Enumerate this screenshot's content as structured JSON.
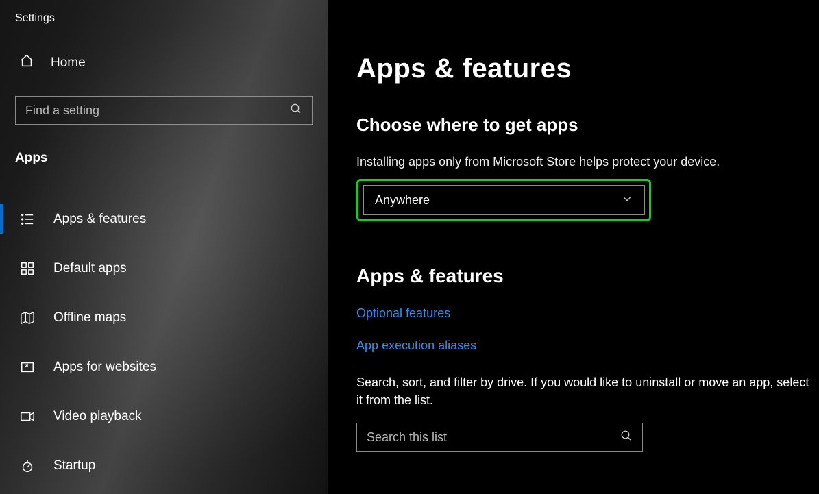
{
  "window": {
    "title": "Settings"
  },
  "sidebar": {
    "home": "Home",
    "search_placeholder": "Find a setting",
    "section": "Apps",
    "items": [
      {
        "label": "Apps & features",
        "active": true
      },
      {
        "label": "Default apps"
      },
      {
        "label": "Offline maps"
      },
      {
        "label": "Apps for websites"
      },
      {
        "label": "Video playback"
      },
      {
        "label": "Startup"
      }
    ]
  },
  "main": {
    "title": "Apps & features",
    "choose_heading": "Choose where to get apps",
    "choose_helper": "Installing apps only from Microsoft Store helps protect your device.",
    "choose_value": "Anywhere",
    "section2_heading": "Apps & features",
    "link_optional": "Optional features",
    "link_aliases": "App execution aliases",
    "list_desc": "Search, sort, and filter by drive. If you would like to uninstall or move an app, select it from the list.",
    "list_search_placeholder": "Search this list"
  }
}
